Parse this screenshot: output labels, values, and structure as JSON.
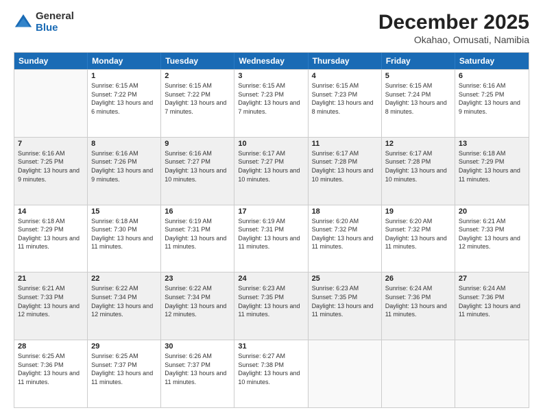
{
  "logo": {
    "general": "General",
    "blue": "Blue"
  },
  "title": "December 2025",
  "location": "Okahao, Omusati, Namibia",
  "days_of_week": [
    "Sunday",
    "Monday",
    "Tuesday",
    "Wednesday",
    "Thursday",
    "Friday",
    "Saturday"
  ],
  "weeks": [
    [
      {
        "day": "",
        "sunrise": "",
        "sunset": "",
        "daylight": ""
      },
      {
        "day": "1",
        "sunrise": "Sunrise: 6:15 AM",
        "sunset": "Sunset: 7:22 PM",
        "daylight": "Daylight: 13 hours and 6 minutes."
      },
      {
        "day": "2",
        "sunrise": "Sunrise: 6:15 AM",
        "sunset": "Sunset: 7:22 PM",
        "daylight": "Daylight: 13 hours and 7 minutes."
      },
      {
        "day": "3",
        "sunrise": "Sunrise: 6:15 AM",
        "sunset": "Sunset: 7:23 PM",
        "daylight": "Daylight: 13 hours and 7 minutes."
      },
      {
        "day": "4",
        "sunrise": "Sunrise: 6:15 AM",
        "sunset": "Sunset: 7:23 PM",
        "daylight": "Daylight: 13 hours and 8 minutes."
      },
      {
        "day": "5",
        "sunrise": "Sunrise: 6:15 AM",
        "sunset": "Sunset: 7:24 PM",
        "daylight": "Daylight: 13 hours and 8 minutes."
      },
      {
        "day": "6",
        "sunrise": "Sunrise: 6:16 AM",
        "sunset": "Sunset: 7:25 PM",
        "daylight": "Daylight: 13 hours and 9 minutes."
      }
    ],
    [
      {
        "day": "7",
        "sunrise": "Sunrise: 6:16 AM",
        "sunset": "Sunset: 7:25 PM",
        "daylight": "Daylight: 13 hours and 9 minutes."
      },
      {
        "day": "8",
        "sunrise": "Sunrise: 6:16 AM",
        "sunset": "Sunset: 7:26 PM",
        "daylight": "Daylight: 13 hours and 9 minutes."
      },
      {
        "day": "9",
        "sunrise": "Sunrise: 6:16 AM",
        "sunset": "Sunset: 7:27 PM",
        "daylight": "Daylight: 13 hours and 10 minutes."
      },
      {
        "day": "10",
        "sunrise": "Sunrise: 6:17 AM",
        "sunset": "Sunset: 7:27 PM",
        "daylight": "Daylight: 13 hours and 10 minutes."
      },
      {
        "day": "11",
        "sunrise": "Sunrise: 6:17 AM",
        "sunset": "Sunset: 7:28 PM",
        "daylight": "Daylight: 13 hours and 10 minutes."
      },
      {
        "day": "12",
        "sunrise": "Sunrise: 6:17 AM",
        "sunset": "Sunset: 7:28 PM",
        "daylight": "Daylight: 13 hours and 10 minutes."
      },
      {
        "day": "13",
        "sunrise": "Sunrise: 6:18 AM",
        "sunset": "Sunset: 7:29 PM",
        "daylight": "Daylight: 13 hours and 11 minutes."
      }
    ],
    [
      {
        "day": "14",
        "sunrise": "Sunrise: 6:18 AM",
        "sunset": "Sunset: 7:29 PM",
        "daylight": "Daylight: 13 hours and 11 minutes."
      },
      {
        "day": "15",
        "sunrise": "Sunrise: 6:18 AM",
        "sunset": "Sunset: 7:30 PM",
        "daylight": "Daylight: 13 hours and 11 minutes."
      },
      {
        "day": "16",
        "sunrise": "Sunrise: 6:19 AM",
        "sunset": "Sunset: 7:31 PM",
        "daylight": "Daylight: 13 hours and 11 minutes."
      },
      {
        "day": "17",
        "sunrise": "Sunrise: 6:19 AM",
        "sunset": "Sunset: 7:31 PM",
        "daylight": "Daylight: 13 hours and 11 minutes."
      },
      {
        "day": "18",
        "sunrise": "Sunrise: 6:20 AM",
        "sunset": "Sunset: 7:32 PM",
        "daylight": "Daylight: 13 hours and 11 minutes."
      },
      {
        "day": "19",
        "sunrise": "Sunrise: 6:20 AM",
        "sunset": "Sunset: 7:32 PM",
        "daylight": "Daylight: 13 hours and 11 minutes."
      },
      {
        "day": "20",
        "sunrise": "Sunrise: 6:21 AM",
        "sunset": "Sunset: 7:33 PM",
        "daylight": "Daylight: 13 hours and 12 minutes."
      }
    ],
    [
      {
        "day": "21",
        "sunrise": "Sunrise: 6:21 AM",
        "sunset": "Sunset: 7:33 PM",
        "daylight": "Daylight: 13 hours and 12 minutes."
      },
      {
        "day": "22",
        "sunrise": "Sunrise: 6:22 AM",
        "sunset": "Sunset: 7:34 PM",
        "daylight": "Daylight: 13 hours and 12 minutes."
      },
      {
        "day": "23",
        "sunrise": "Sunrise: 6:22 AM",
        "sunset": "Sunset: 7:34 PM",
        "daylight": "Daylight: 13 hours and 12 minutes."
      },
      {
        "day": "24",
        "sunrise": "Sunrise: 6:23 AM",
        "sunset": "Sunset: 7:35 PM",
        "daylight": "Daylight: 13 hours and 11 minutes."
      },
      {
        "day": "25",
        "sunrise": "Sunrise: 6:23 AM",
        "sunset": "Sunset: 7:35 PM",
        "daylight": "Daylight: 13 hours and 11 minutes."
      },
      {
        "day": "26",
        "sunrise": "Sunrise: 6:24 AM",
        "sunset": "Sunset: 7:36 PM",
        "daylight": "Daylight: 13 hours and 11 minutes."
      },
      {
        "day": "27",
        "sunrise": "Sunrise: 6:24 AM",
        "sunset": "Sunset: 7:36 PM",
        "daylight": "Daylight: 13 hours and 11 minutes."
      }
    ],
    [
      {
        "day": "28",
        "sunrise": "Sunrise: 6:25 AM",
        "sunset": "Sunset: 7:36 PM",
        "daylight": "Daylight: 13 hours and 11 minutes."
      },
      {
        "day": "29",
        "sunrise": "Sunrise: 6:25 AM",
        "sunset": "Sunset: 7:37 PM",
        "daylight": "Daylight: 13 hours and 11 minutes."
      },
      {
        "day": "30",
        "sunrise": "Sunrise: 6:26 AM",
        "sunset": "Sunset: 7:37 PM",
        "daylight": "Daylight: 13 hours and 11 minutes."
      },
      {
        "day": "31",
        "sunrise": "Sunrise: 6:27 AM",
        "sunset": "Sunset: 7:38 PM",
        "daylight": "Daylight: 13 hours and 10 minutes."
      },
      {
        "day": "",
        "sunrise": "",
        "sunset": "",
        "daylight": ""
      },
      {
        "day": "",
        "sunrise": "",
        "sunset": "",
        "daylight": ""
      },
      {
        "day": "",
        "sunrise": "",
        "sunset": "",
        "daylight": ""
      }
    ]
  ]
}
